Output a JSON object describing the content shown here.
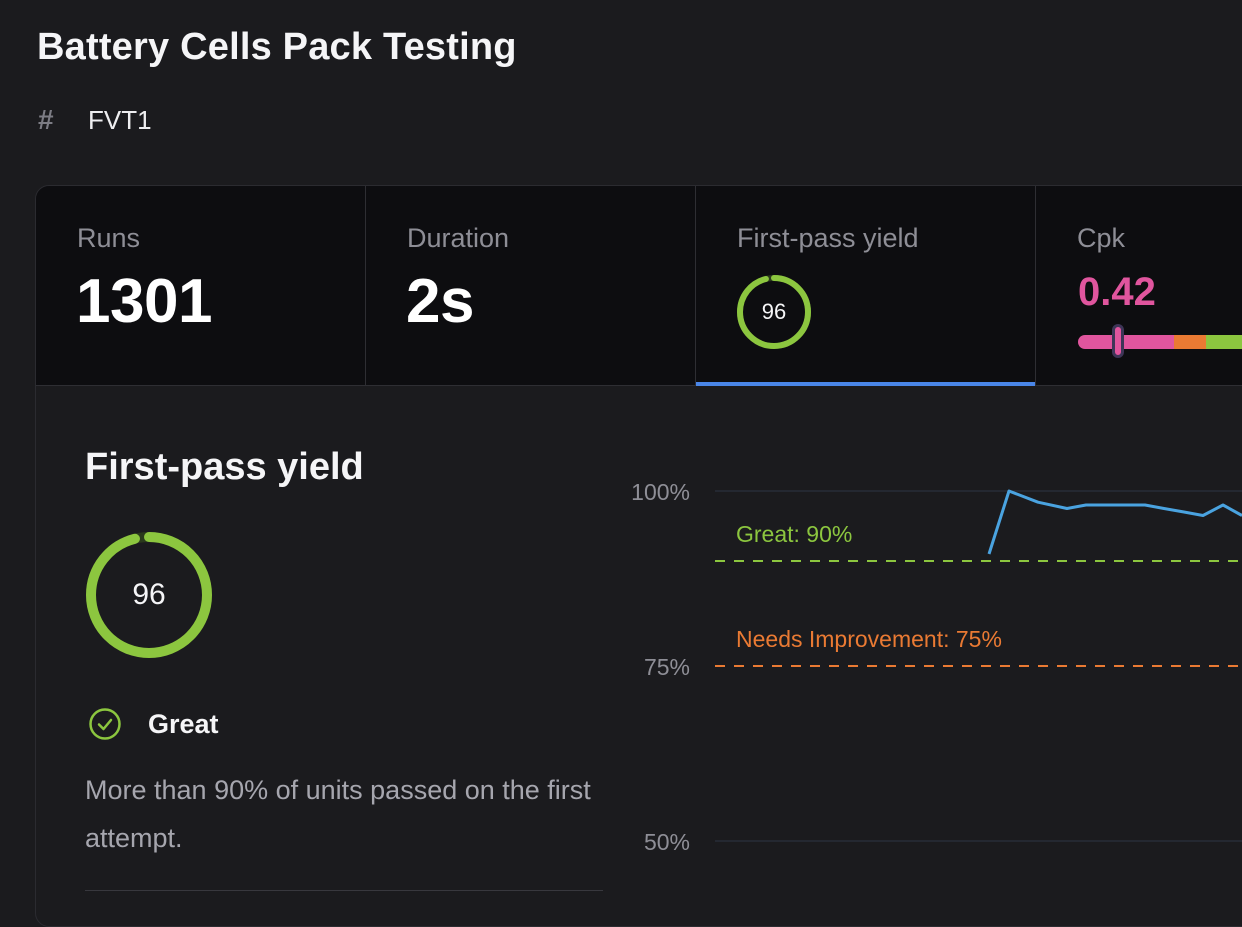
{
  "header": {
    "title": "Battery Cells Pack Testing",
    "station_icon": "#",
    "station": "FVT1"
  },
  "stats": {
    "runs": {
      "label": "Runs",
      "value": "1301"
    },
    "duration": {
      "label": "Duration",
      "value": "2s"
    },
    "fpy": {
      "label": "First-pass yield",
      "value": "96",
      "fraction": 0.96
    },
    "cpk": {
      "label": "Cpk",
      "value": "0.42",
      "color": "#e0559e"
    }
  },
  "detail": {
    "title": "First-pass yield",
    "value": "96",
    "rating": "Great",
    "description": "More than 90% of units passed on the first attempt."
  },
  "colors": {
    "accent": "#4a86e8",
    "great": "#8cc63f",
    "needs_improvement": "#ea7a33",
    "poor": "#e0559e",
    "line": "#4aa3e0"
  },
  "chart_data": {
    "type": "line",
    "y_ticks": [
      "100%",
      "75%",
      "50%"
    ],
    "ylim": [
      50,
      100
    ],
    "thresholds": [
      {
        "label": "Great: 90%",
        "value": 90,
        "color": "#8cc63f"
      },
      {
        "label": "Needs Improvement: 75%",
        "value": 75,
        "color": "#ea7a33"
      }
    ],
    "series": [
      {
        "values": [
          91,
          100,
          98.4,
          97.5,
          98,
          98,
          98,
          98,
          97.5,
          97,
          96.5,
          98,
          96.5
        ]
      }
    ]
  }
}
